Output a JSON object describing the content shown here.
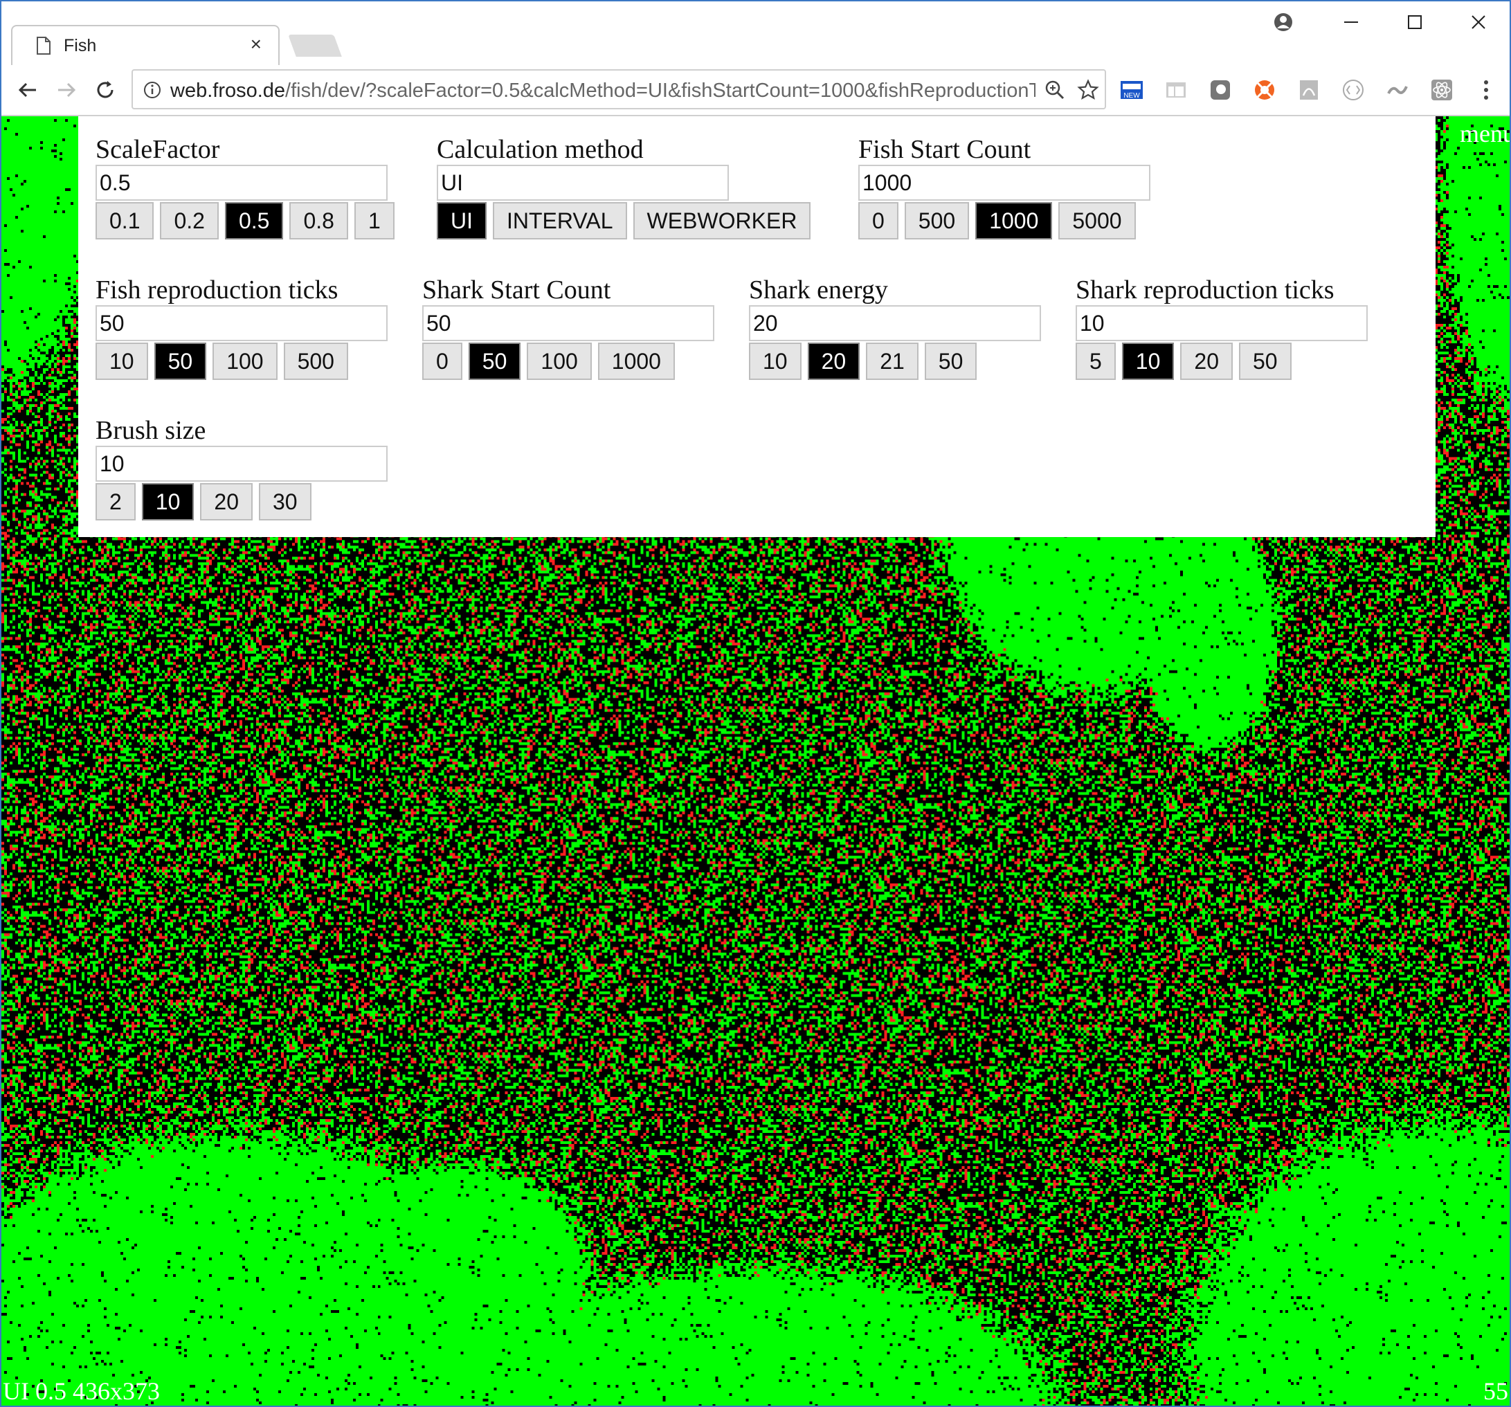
{
  "browser": {
    "tab_title": "Fish",
    "tab_close": "×",
    "url_host": "web.froso.de",
    "url_rest": "/fish/dev/?scaleFactor=0.5&calcMethod=UI&fishStartCount=1000&fishReproductionT..."
  },
  "page": {
    "menu_label": "menu",
    "status_left": "UI 0.5 436x373",
    "status_right": "55"
  },
  "settings": [
    {
      "label": "ScaleFactor",
      "value": "0.5",
      "options": [
        "0.1",
        "0.2",
        "0.5",
        "0.8",
        "1"
      ],
      "selected": "0.5"
    },
    {
      "label": "Calculation method",
      "value": "UI",
      "options": [
        "UI",
        "INTERVAL",
        "WEBWORKER"
      ],
      "selected": "UI"
    },
    {
      "label": "Fish Start Count",
      "value": "1000",
      "options": [
        "0",
        "500",
        "1000",
        "5000"
      ],
      "selected": "1000"
    },
    {
      "label": "Fish reproduction ticks",
      "value": "50",
      "options": [
        "10",
        "50",
        "100",
        "500"
      ],
      "selected": "50"
    },
    {
      "label": "Shark Start Count",
      "value": "50",
      "options": [
        "0",
        "50",
        "100",
        "1000"
      ],
      "selected": "50"
    },
    {
      "label": "Shark energy",
      "value": "20",
      "options": [
        "10",
        "20",
        "21",
        "50"
      ],
      "selected": "20"
    },
    {
      "label": "Shark reproduction ticks",
      "value": "10",
      "options": [
        "5",
        "10",
        "20",
        "50"
      ],
      "selected": "10"
    },
    {
      "label": "Brush size",
      "value": "10",
      "options": [
        "2",
        "10",
        "20",
        "30"
      ],
      "selected": "10"
    }
  ],
  "colors": {
    "fish": "#00ff00",
    "shark": "#ff2020",
    "water": "#000000"
  },
  "icons": {
    "back": "arrow-left-icon",
    "forward": "arrow-right-icon",
    "reload": "reload-icon",
    "info": "info-icon",
    "zoom": "zoom-icon",
    "bookmark": "star-icon",
    "profile": "profile-icon",
    "menu": "kebab-menu-icon"
  }
}
